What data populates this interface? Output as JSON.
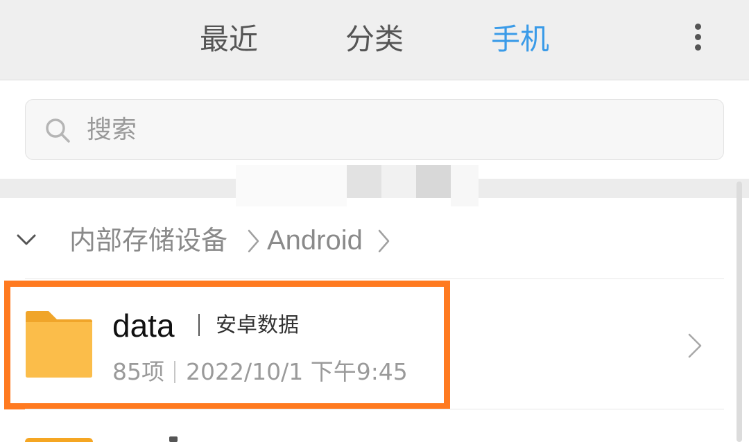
{
  "theme": {
    "accent": "#3a9be8",
    "highlight": "#ff7a20",
    "folder": "#fbbd4a",
    "folder_tab": "#f0a52a"
  },
  "tabs": [
    {
      "label": "最近"
    },
    {
      "label": "分类"
    },
    {
      "label": "手机",
      "active": true
    }
  ],
  "toolbar": {
    "more_icon": "more-vertical-icon"
  },
  "search": {
    "placeholder": "搜索",
    "value": "",
    "icon": "search-icon"
  },
  "breadcrumb": {
    "collapse_icon": "chevron-down-icon",
    "items": [
      {
        "label": "内部存储设备"
      },
      {
        "label": "Android"
      }
    ]
  },
  "files": [
    {
      "name": "data",
      "description": "安卓数据",
      "count": "85项",
      "modified": "2022/10/1 下午9:45",
      "icon": "folder-icon"
    }
  ]
}
